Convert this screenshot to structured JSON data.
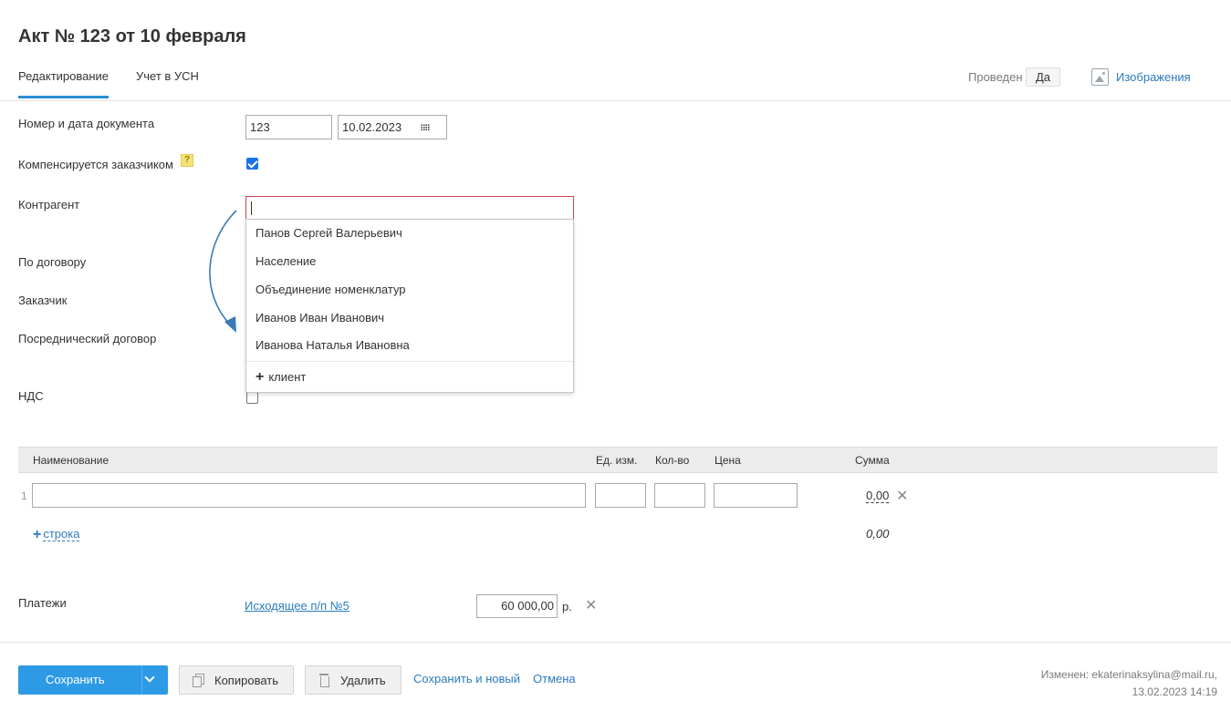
{
  "page": {
    "title": "Акт № 123 от 10 февраля"
  },
  "tabs": [
    {
      "label": "Редактирование",
      "active": true
    },
    {
      "label": "Учет в УСН",
      "active": false
    }
  ],
  "header": {
    "posted_label": "Проведен",
    "posted_value": "Да",
    "images_label": "Изображения",
    "images_icon": "image-icon"
  },
  "form": {
    "doc_label": "Номер и дата документа",
    "doc_number": "123",
    "doc_date": "10.02.2023",
    "compensated_label": "Компенсируется заказчиком",
    "compensated_checked": true,
    "help_glyph": "?",
    "contractor_label": "Контрагент",
    "contractor_value": "",
    "contract_label": "По договору",
    "customer_label": "Заказчик",
    "agency_label": "Посреднический договор",
    "vat_label": "НДС",
    "vat_checked": false
  },
  "dropdown": {
    "items": [
      "Панов Сергей Валерьевич",
      "Население",
      "Объединение номенклатур",
      "Иванов Иван Иванович",
      "Иванова Наталья Ивановна"
    ],
    "add_glyph": "+",
    "add_label": "клиент"
  },
  "table": {
    "columns": [
      "Наименование",
      "Ед. изм.",
      "Кол-во",
      "Цена",
      "Сумма"
    ],
    "rows": [
      {
        "num": "1",
        "name": "",
        "unit": "",
        "qty": "",
        "price": "",
        "sum": "0,00"
      }
    ],
    "add_row_glyph": "+",
    "add_row_label": "строка",
    "total": "0,00",
    "delete_glyph": "✕"
  },
  "payments": {
    "label": "Платежи",
    "link": "Исходящее п/п №5",
    "amount": "60 000,00",
    "currency": "р.",
    "delete_glyph": "✕"
  },
  "footer": {
    "save_label": "Сохранить",
    "copy_label": "Копировать",
    "delete_label": "Удалить",
    "save_new_label": "Сохранить и новый",
    "cancel_label": "Отмена",
    "changed_line1": "Изменен: ekaterinaksylina@mail.ru,",
    "changed_line2": "13.02.2023 14:19"
  },
  "colors": {
    "accent": "#2d9ae6",
    "link": "#2b7bbd",
    "error_border": "#d0434d",
    "arrow": "#3a7ab8"
  }
}
